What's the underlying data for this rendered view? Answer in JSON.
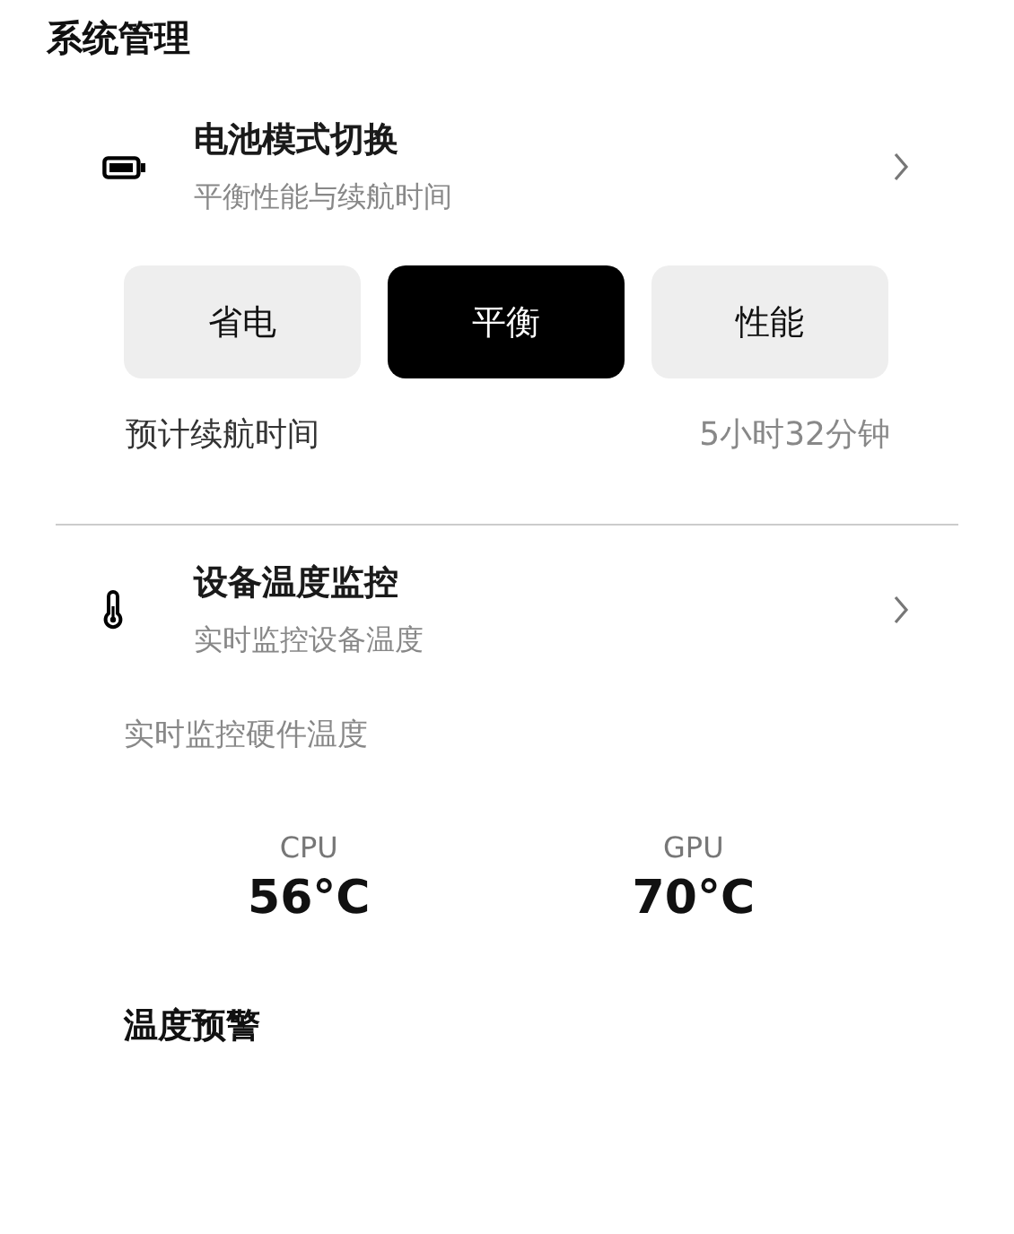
{
  "title": "系统管理",
  "battery": {
    "title": "电池模式切换",
    "subtitle": "平衡性能与续航时间",
    "modes": [
      {
        "label": "省电",
        "selected": false
      },
      {
        "label": "平衡",
        "selected": true
      },
      {
        "label": "性能",
        "selected": false
      }
    ],
    "estimate_label": "预计续航时间",
    "estimate_value": "5小时32分钟"
  },
  "temperature": {
    "title": "设备温度监控",
    "subtitle": "实时监控设备温度",
    "caption": "实时监控硬件温度",
    "readings": [
      {
        "name": "CPU",
        "value": "56°C"
      },
      {
        "name": "GPU",
        "value": "70°C"
      }
    ],
    "warning_title": "温度预警"
  }
}
